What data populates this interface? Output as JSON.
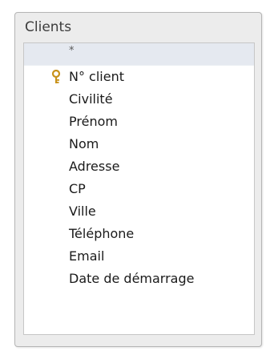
{
  "table": {
    "title": "Clients",
    "all_fields_label": "*",
    "fields": [
      {
        "label": "N° client",
        "primary_key": true,
        "icon": "key-icon",
        "key_color": "#d9a521"
      },
      {
        "label": "Civilité"
      },
      {
        "label": "Prénom"
      },
      {
        "label": "Nom"
      },
      {
        "label": "Adresse"
      },
      {
        "label": "CP"
      },
      {
        "label": "Ville"
      },
      {
        "label": "Téléphone"
      },
      {
        "label": "Email"
      },
      {
        "label": "Date de démarrage"
      }
    ]
  }
}
